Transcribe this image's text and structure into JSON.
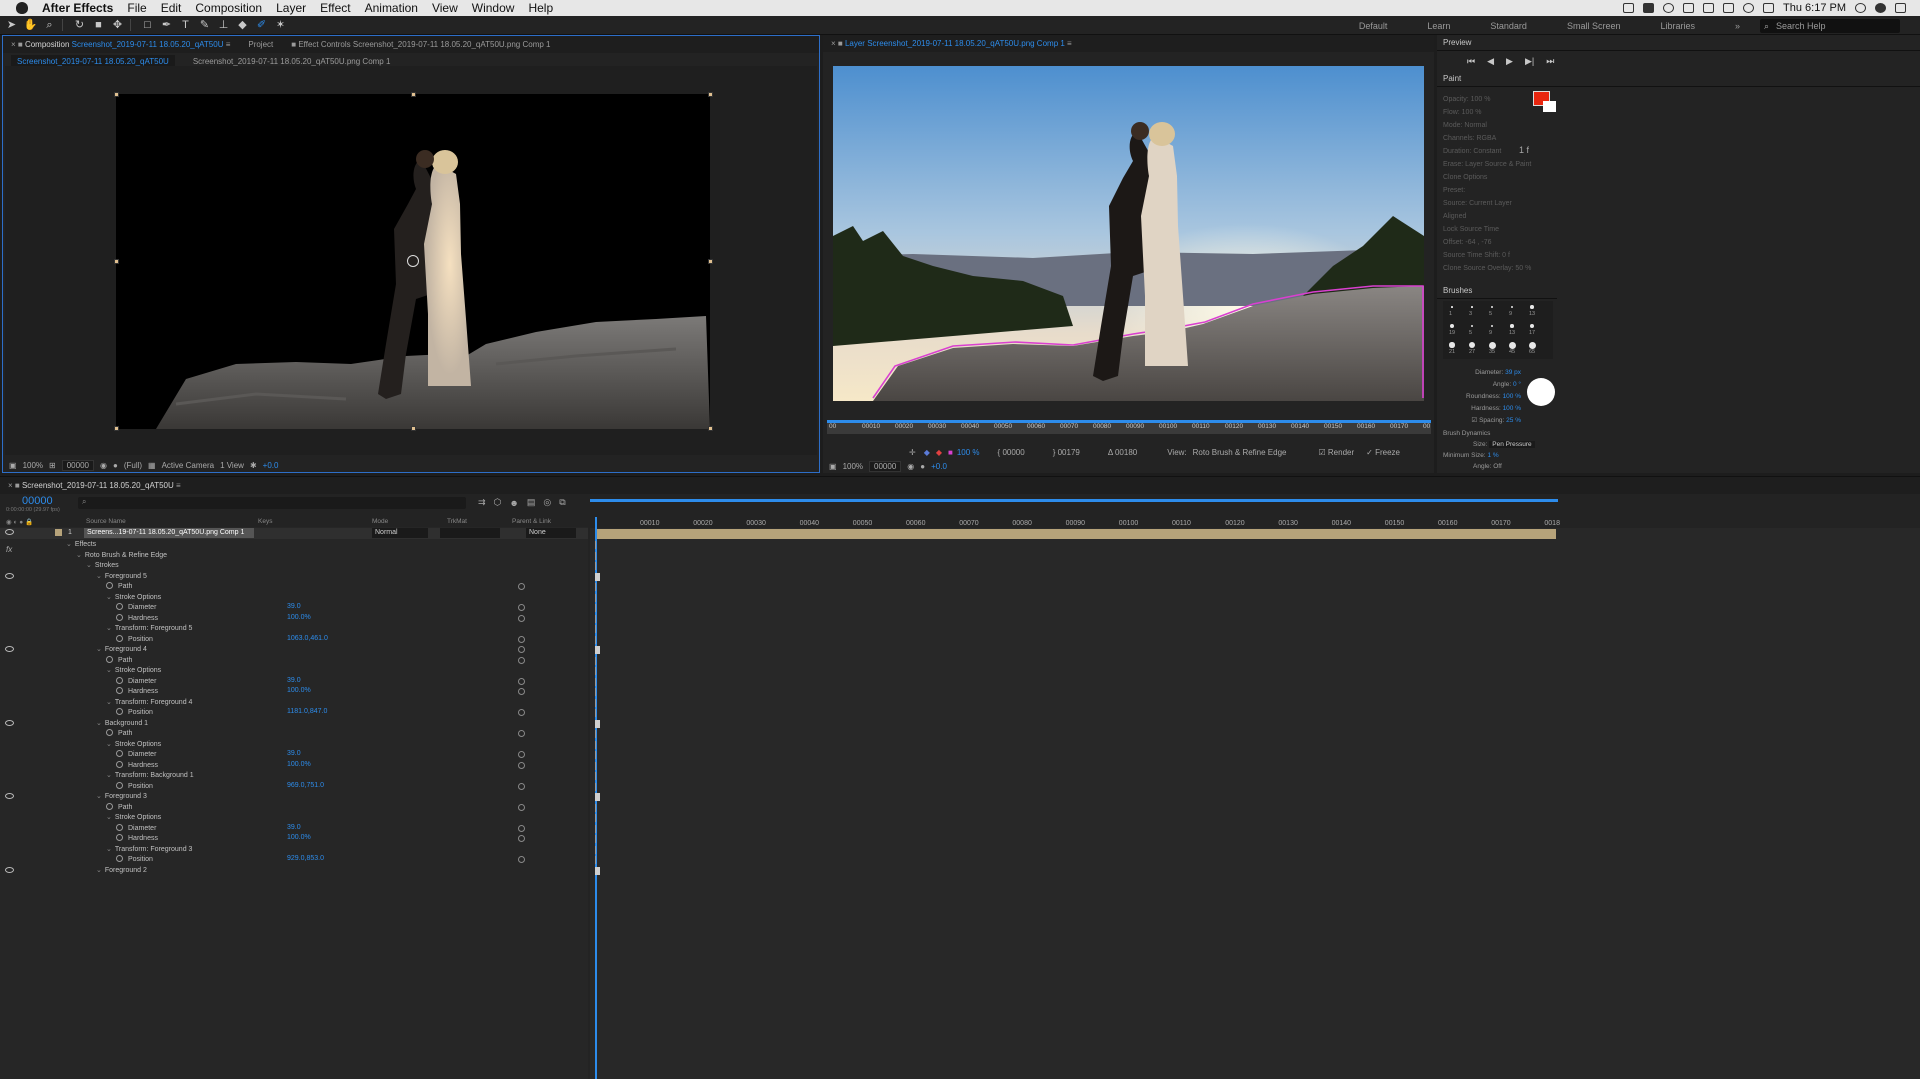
{
  "menubar": {
    "app": "After Effects",
    "items": [
      "File",
      "Edit",
      "Composition",
      "Layer",
      "Effect",
      "Animation",
      "View",
      "Window",
      "Help"
    ],
    "clock": "Thu 6:17 PM"
  },
  "toolbar": {
    "workspaces": [
      "Default",
      "Learn",
      "Standard",
      "Small Screen",
      "Libraries"
    ],
    "search_placeholder": "Search Help"
  },
  "comp_panel": {
    "tab_comp_prefix": "Composition",
    "tab_comp_name": "Screenshot_2019-07-11 18.05.20_qAT50U",
    "tab_project": "Project",
    "tab_effects": "Effect Controls Screenshot_2019-07-11 18.05.20_qAT50U.png Comp 1",
    "sub_tab_active": "Screenshot_2019-07-11 18.05.20_qAT50U",
    "sub_tab_other": "Screenshot_2019-07-11 18.05.20_qAT50U.png Comp 1",
    "footer": {
      "zoom": "100%",
      "timecode": "00000",
      "resolution": "(Full)",
      "camera": "Active Camera",
      "views": "1 View",
      "exposure": "+0.0"
    }
  },
  "layer_panel": {
    "tab_prefix": "Layer",
    "tab_name": "Screenshot_2019-07-11 18.05.20_qAT50U.png Comp 1",
    "ruler_labels": [
      "00",
      "00010",
      "00020",
      "00030",
      "00040",
      "00050",
      "00060",
      "00070",
      "00080",
      "00090",
      "00100",
      "00110",
      "00120",
      "00130",
      "00140",
      "00150",
      "00160",
      "00170",
      "00"
    ],
    "controls": {
      "opacity": "100 %",
      "start": "00000",
      "end": "00179",
      "duration": "Δ 00180",
      "view_label": "View:",
      "view_value": "Roto Brush & Refine Edge",
      "render": "Render",
      "freeze": "Freeze"
    },
    "footer": {
      "zoom": "100%",
      "timecode": "00000",
      "exposure": "+0.0"
    }
  },
  "right_panel": {
    "preview_title": "Preview",
    "paint_title": "Paint",
    "paint_rows": [
      "Opacity: 100 %",
      "Flow: 100 %",
      "Mode: Normal",
      "Channels: RGBA",
      "Duration: Constant",
      "Erase: Layer Source & Paint",
      "Clone Options",
      "Preset:",
      "Source: Current Layer",
      "Aligned",
      "Lock Source Time",
      "Offset: -64 , -76",
      "Source Time Shift: 0 f",
      "Clone Source Overlay: 50 %"
    ],
    "duration_extra": "1 f",
    "brushes_title": "Brushes",
    "brush_sizes": [
      "1",
      "3",
      "5",
      "9",
      "13",
      "19",
      "5",
      "9",
      "13",
      "17",
      "21",
      "27",
      "35",
      "45",
      "65"
    ],
    "brush_props": {
      "diameter_label": "Diameter:",
      "diameter": "39 px",
      "angle_label": "Angle:",
      "angle": "0 °",
      "roundness_label": "Roundness:",
      "roundness": "100 %",
      "hardness_label": "Hardness:",
      "hardness": "100 %",
      "spacing_label": "Spacing:",
      "spacing": "25 %"
    },
    "brush_dynamics_title": "Brush Dynamics",
    "size_label": "Size:",
    "size_value": "Pen Pressure",
    "min_size_label": "Minimum Size:",
    "min_size_value": "1 %",
    "angle_label2": "Angle:",
    "angle_value2": "Off"
  },
  "timeline": {
    "tab": "Screenshot_2019-07-11 18.05.20_qAT50U",
    "timecode": "00000",
    "fps": "0:00:00:00 (29.97 fps)",
    "col_source": "Source Name",
    "col_keys": "Keys",
    "col_mode": "Mode",
    "col_trkmat": "TrkMat",
    "col_parent": "Parent & Link",
    "layer_num": "1",
    "layer_name": "Screens...19-07-11 18.05.20_qAT50U.png Comp 1",
    "layer_mode": "Normal",
    "layer_parent": "None",
    "ruler": [
      "00010",
      "00020",
      "00030",
      "00040",
      "00050",
      "00060",
      "00070",
      "00080",
      "00090",
      "00100",
      "00110",
      "00120",
      "00130",
      "00140",
      "00150",
      "00160",
      "00170",
      "0018"
    ],
    "rows": [
      {
        "label": "Effects",
        "indent": 0,
        "twirl": "open"
      },
      {
        "label": "Roto Brush & Refine Edge",
        "indent": 1,
        "twirl": "open"
      },
      {
        "label": "Strokes",
        "indent": 2,
        "twirl": "open"
      },
      {
        "label": "Foreground 5",
        "indent": 3,
        "twirl": "open",
        "eye": true
      },
      {
        "label": "Path",
        "indent": 4,
        "sw": true,
        "spiral": true
      },
      {
        "label": "Stroke Options",
        "indent": 4,
        "twirl": "open"
      },
      {
        "label": "Diameter",
        "indent": 5,
        "sw": true,
        "value": "39.0",
        "spiral": true
      },
      {
        "label": "Hardness",
        "indent": 5,
        "sw": true,
        "value": "100.0%",
        "spiral": true
      },
      {
        "label": "Transform: Foreground 5",
        "indent": 4,
        "twirl": "open"
      },
      {
        "label": "Position",
        "indent": 5,
        "sw": true,
        "value": "1063.0,461.0",
        "spiral": true
      },
      {
        "label": "Foreground 4",
        "indent": 3,
        "twirl": "open",
        "eye": true,
        "spiral": true
      },
      {
        "label": "Path",
        "indent": 4,
        "sw": true,
        "spiral": true
      },
      {
        "label": "Stroke Options",
        "indent": 4,
        "twirl": "open"
      },
      {
        "label": "Diameter",
        "indent": 5,
        "sw": true,
        "value": "39.0",
        "spiral": true
      },
      {
        "label": "Hardness",
        "indent": 5,
        "sw": true,
        "value": "100.0%",
        "spiral": true
      },
      {
        "label": "Transform: Foreground 4",
        "indent": 4,
        "twirl": "open"
      },
      {
        "label": "Position",
        "indent": 5,
        "sw": true,
        "value": "1181.0,847.0",
        "spiral": true
      },
      {
        "label": "Background 1",
        "indent": 3,
        "twirl": "open",
        "eye": true
      },
      {
        "label": "Path",
        "indent": 4,
        "sw": true,
        "spiral": true
      },
      {
        "label": "Stroke Options",
        "indent": 4,
        "twirl": "open"
      },
      {
        "label": "Diameter",
        "indent": 5,
        "sw": true,
        "value": "39.0",
        "spiral": true
      },
      {
        "label": "Hardness",
        "indent": 5,
        "sw": true,
        "value": "100.0%",
        "spiral": true
      },
      {
        "label": "Transform: Background 1",
        "indent": 4,
        "twirl": "open"
      },
      {
        "label": "Position",
        "indent": 5,
        "sw": true,
        "value": "969.0,751.0",
        "spiral": true
      },
      {
        "label": "Foreground 3",
        "indent": 3,
        "twirl": "open",
        "eye": true
      },
      {
        "label": "Path",
        "indent": 4,
        "sw": true,
        "spiral": true
      },
      {
        "label": "Stroke Options",
        "indent": 4,
        "twirl": "open"
      },
      {
        "label": "Diameter",
        "indent": 5,
        "sw": true,
        "value": "39.0",
        "spiral": true
      },
      {
        "label": "Hardness",
        "indent": 5,
        "sw": true,
        "value": "100.0%",
        "spiral": true
      },
      {
        "label": "Transform: Foreground 3",
        "indent": 4,
        "twirl": "open"
      },
      {
        "label": "Position",
        "indent": 5,
        "sw": true,
        "value": "929.0,853.0",
        "spiral": true
      },
      {
        "label": "Foreground 2",
        "indent": 3,
        "twirl": "open",
        "eye": true
      }
    ]
  },
  "colors": {
    "accent_blue": "#2d8ceb",
    "paint_fg": "#e8260f",
    "roto_outline": "#d940d0",
    "layer_bar": "#b6a37a"
  }
}
